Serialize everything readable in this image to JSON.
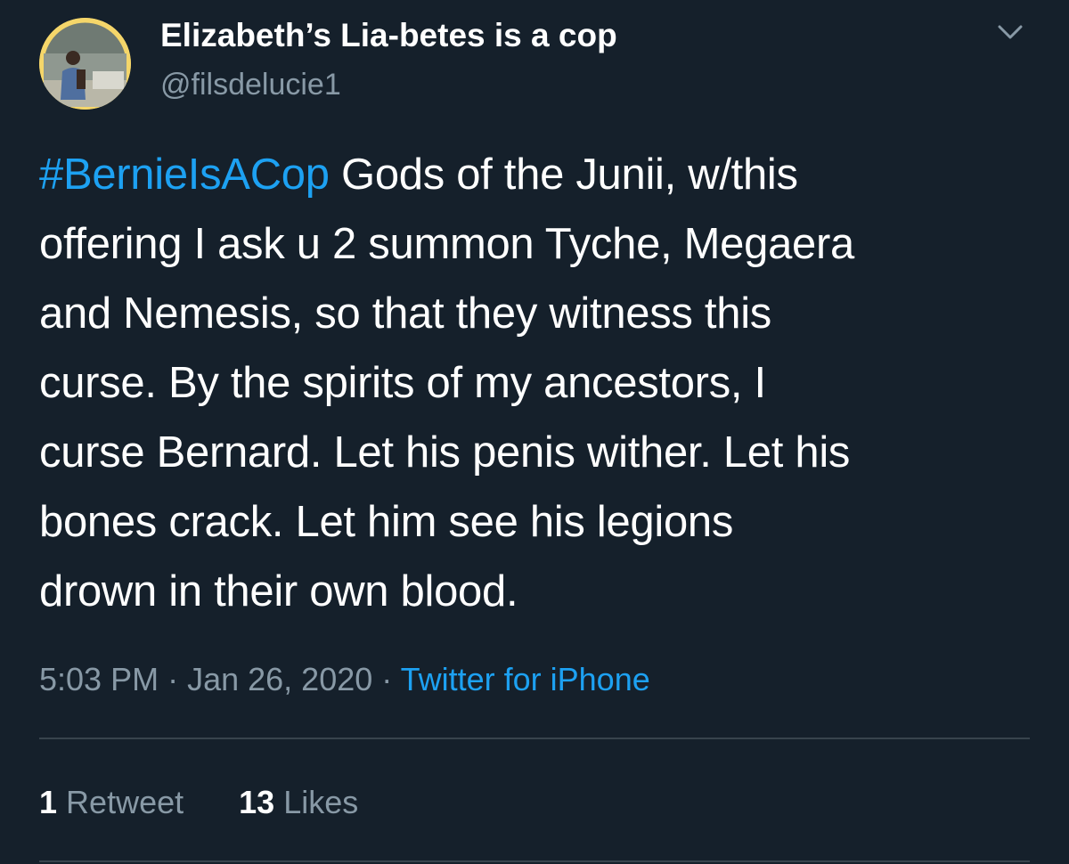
{
  "tweet": {
    "author": {
      "display_name": "Elizabeth’s Lia-betes is a cop",
      "handle": "@filsdelucie1"
    },
    "text": {
      "hashtag": "#BernieIsACop",
      "line1_rest": " Gods of the Junii, w/this",
      "lines": [
        "offering I ask u 2 summon Tyche, Megaera",
        "and Nemesis, so that they witness this",
        "curse. By the spirits of my ancestors, I",
        "curse Bernard. Let his penis wither. Let his",
        "bones crack. Let him see his legions",
        "drown in their own blood."
      ]
    },
    "time": "5:03 PM",
    "separator": " · ",
    "date": "Jan 26, 2020",
    "source": "Twitter for iPhone",
    "stats": {
      "retweets_count": "1",
      "retweets_label": "Retweet",
      "likes_count": "13",
      "likes_label": "Likes"
    }
  },
  "icons": {
    "menu": "chevron-down-icon",
    "avatar": "avatar-photo"
  },
  "colors": {
    "background": "#15202b",
    "link": "#1da1f2",
    "secondary_text": "#8899a6",
    "divider": "#38444d",
    "avatar_ring": "#f5d66a"
  }
}
